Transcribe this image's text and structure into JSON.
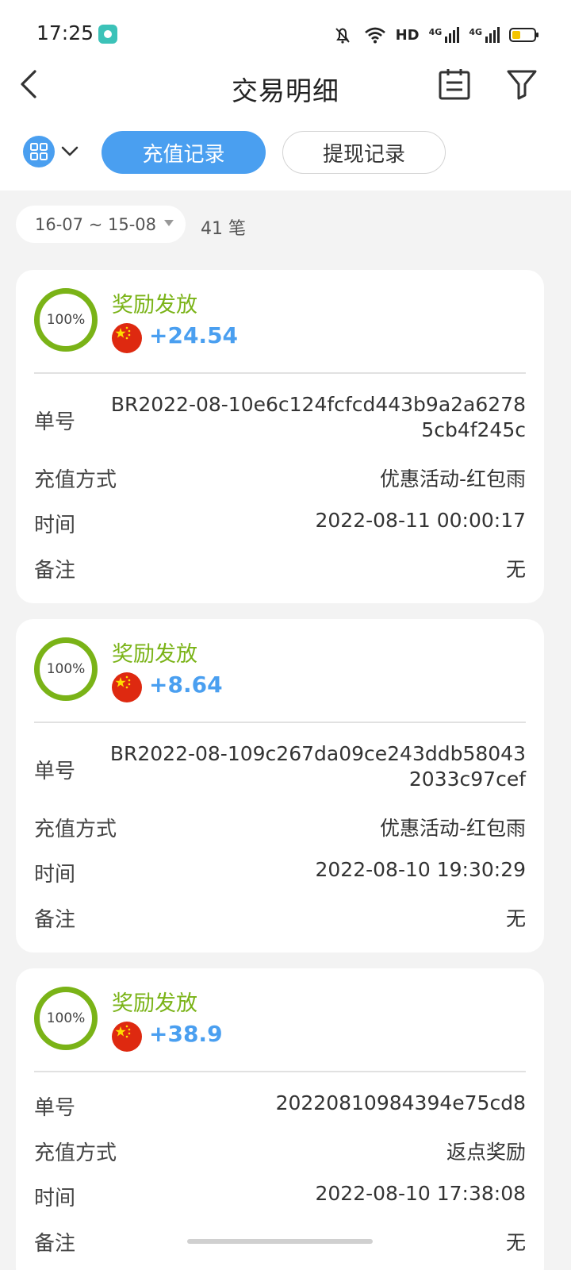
{
  "status_bar": {
    "time": "17:25",
    "network_label_1": "HD",
    "network_label_2": "4G",
    "network_label_3": "4G"
  },
  "header": {
    "title": "交易明细",
    "back_icon": "back-arrow-icon",
    "calendar_icon": "calendar-icon",
    "filter_icon": "filter-funnel-icon"
  },
  "tabs": {
    "items": [
      {
        "label": "充值记录",
        "active": true
      },
      {
        "label": "提现记录",
        "active": false
      }
    ]
  },
  "date_filter": {
    "range": "16-07 ~ 15-08",
    "count": "41 笔"
  },
  "records": [
    {
      "progress": "100%",
      "status": "奖励发放",
      "amount": "+24.54",
      "order_label": "单号",
      "order_value": "BR2022-08-10e6c124fcfcd443b9a2a6278 5cb4f245c",
      "method_label": "充值方式",
      "method_value": "优惠活动-红包雨",
      "time_label": "时间",
      "time_value": "2022-08-11 00:00:17",
      "note_label": "备注",
      "note_value": "无"
    },
    {
      "progress": "100%",
      "status": "奖励发放",
      "amount": "+8.64",
      "order_label": "单号",
      "order_value": "BR2022-08-109c267da09ce243ddb58043 2033c97cef",
      "method_label": "充值方式",
      "method_value": "优惠活动-红包雨",
      "time_label": "时间",
      "time_value": "2022-08-10 19:30:29",
      "note_label": "备注",
      "note_value": "无"
    },
    {
      "progress": "100%",
      "status": "奖励发放",
      "amount": "+38.9",
      "order_label": "单号",
      "order_value": "20220810984394e75cd8",
      "method_label": "充值方式",
      "method_value": "返点奖励",
      "time_label": "时间",
      "time_value": "2022-08-10 17:38:08",
      "note_label": "备注",
      "note_value": "无"
    }
  ],
  "colors": {
    "accent": "#4a9ff0",
    "success": "#7ab317",
    "flag_red": "#de2910"
  }
}
